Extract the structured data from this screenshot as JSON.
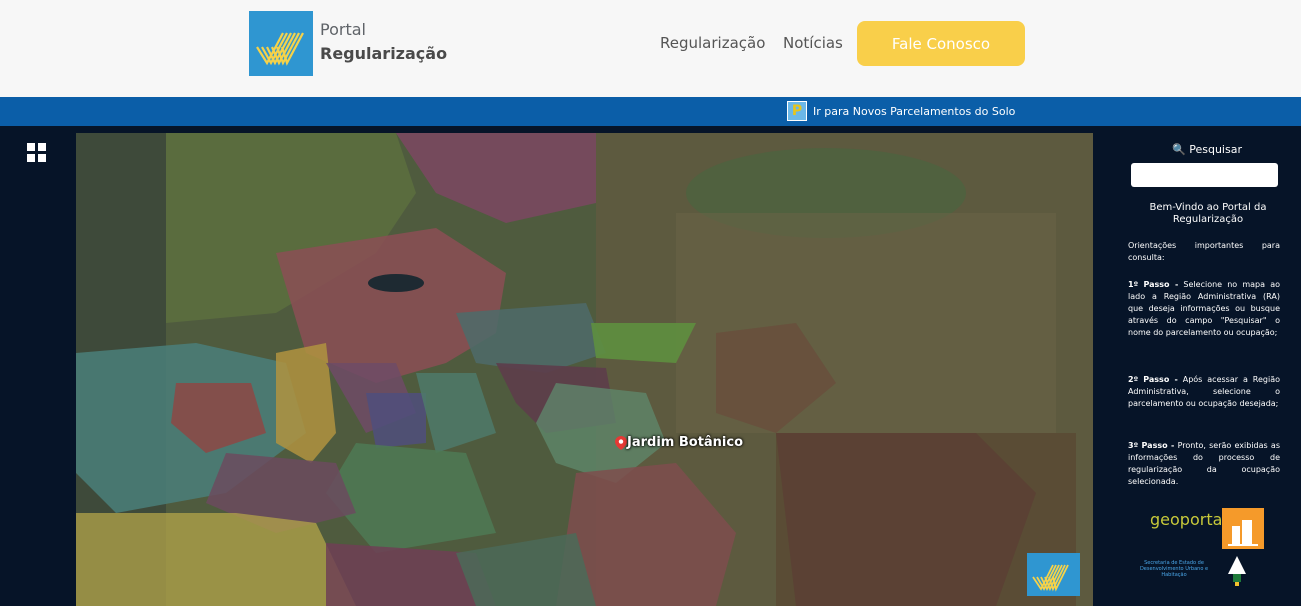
{
  "header": {
    "logo_line1": "Portal",
    "logo_line2": "Regularização",
    "nav": [
      {
        "label": "Regularização"
      },
      {
        "label": "Notícias"
      }
    ],
    "cta_label": "Fale Conosco"
  },
  "bluebar": {
    "icon_letter": "P",
    "link_text": "Ir para Novos Parcelamentos do Solo"
  },
  "map": {
    "marker_label": "Jardim Botânico"
  },
  "panel": {
    "search_label": "Pesquisar",
    "search_value": "",
    "welcome": "Bem-Vindo ao Portal da Regularização",
    "intro": "Orientações importantes para consulta:",
    "steps": [
      {
        "title": "1º Passo -",
        "text": " Selecione no mapa ao lado a Região Administrativa (RA) que deseja informações ou busque através do campo \"Pesquisar\" o nome do parcelamento ou ocupação;"
      },
      {
        "title": "2º Passo -",
        "text": " Após acessar a Região Administrativa, selecione o parcelamento ou ocupação desejada;"
      },
      {
        "title": "3º Passo -",
        "text": " Pronto, serão exibidas as informações do processo de regularização da ocupação selecionada."
      }
    ],
    "geo_logo": "geoportal",
    "seduh_text": "Secretaria de Estado de Desenvolvimento Urbano e Habitação"
  },
  "colors": {
    "accent_yellow": "#f9cf4a",
    "bar_blue": "#0b5ea8",
    "logo_blue": "#2f96d1",
    "panel_bg": "#061428"
  }
}
